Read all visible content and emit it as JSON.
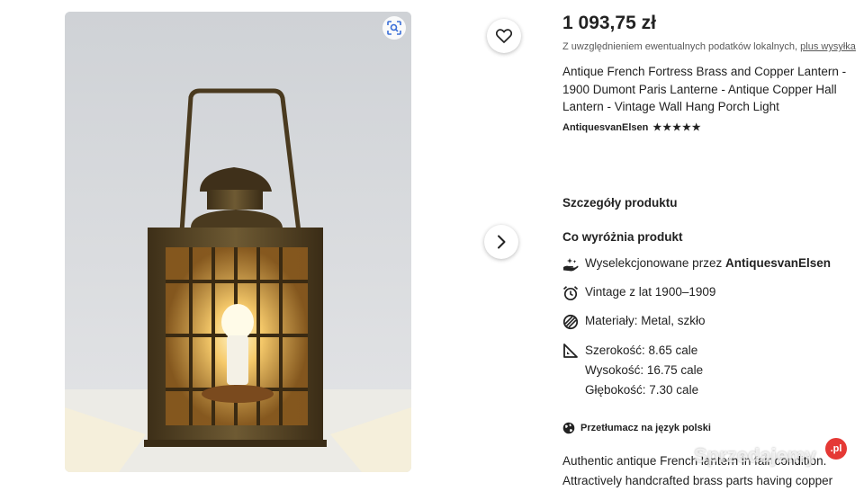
{
  "listing": {
    "price": "1 093,75 zł",
    "tax_note": "Z uwzględnieniem ewentualnych podatków lokalnych, ",
    "tax_link": "plus wysyłka",
    "title": "Antique French Fortress Brass and Copper Lantern - 1900 Dumont Paris Lanterne - Antique Copper Hall Lantern - Vintage Wall Hang Porch Light",
    "seller": "AntiquesvanElsen",
    "rating_stars": "★★★★★",
    "rating": 5
  },
  "details": {
    "heading": "Szczegóły produktu",
    "highlights_heading": "Co wyróżnia produkt",
    "curated_prefix": "Wyselekcjonowane przez ",
    "curated_by": "AntiquesvanElsen",
    "vintage": "Vintage z lat 1900–1909",
    "materials": "Materiały: Metal, szkło",
    "width": "Szerokość: 8.65 cale",
    "height": "Wysokość: 16.75 cale",
    "depth": "Głębokość: 7.30 cale"
  },
  "translation": {
    "label": "Przetłumacz na język polski"
  },
  "description": {
    "line1": "Authentic antique French lantern in fair condition.",
    "line2": "Attractively handcrafted brass parts having copper"
  },
  "watermark": {
    "text": "Sprzedajemy",
    "badge": ".pl"
  },
  "icons": {
    "favorite": "heart-icon",
    "next": "chevron-right-icon",
    "visual_search": "visual-search-icon",
    "curated": "hand-sparkle-icon",
    "vintage": "alarm-clock-icon",
    "materials": "material-swatch-icon",
    "dimensions": "ruler-angle-icon",
    "translate": "globe-icon"
  },
  "colors": {
    "text": "#222222",
    "muted": "#595959",
    "watermark_badge": "#e53935"
  }
}
